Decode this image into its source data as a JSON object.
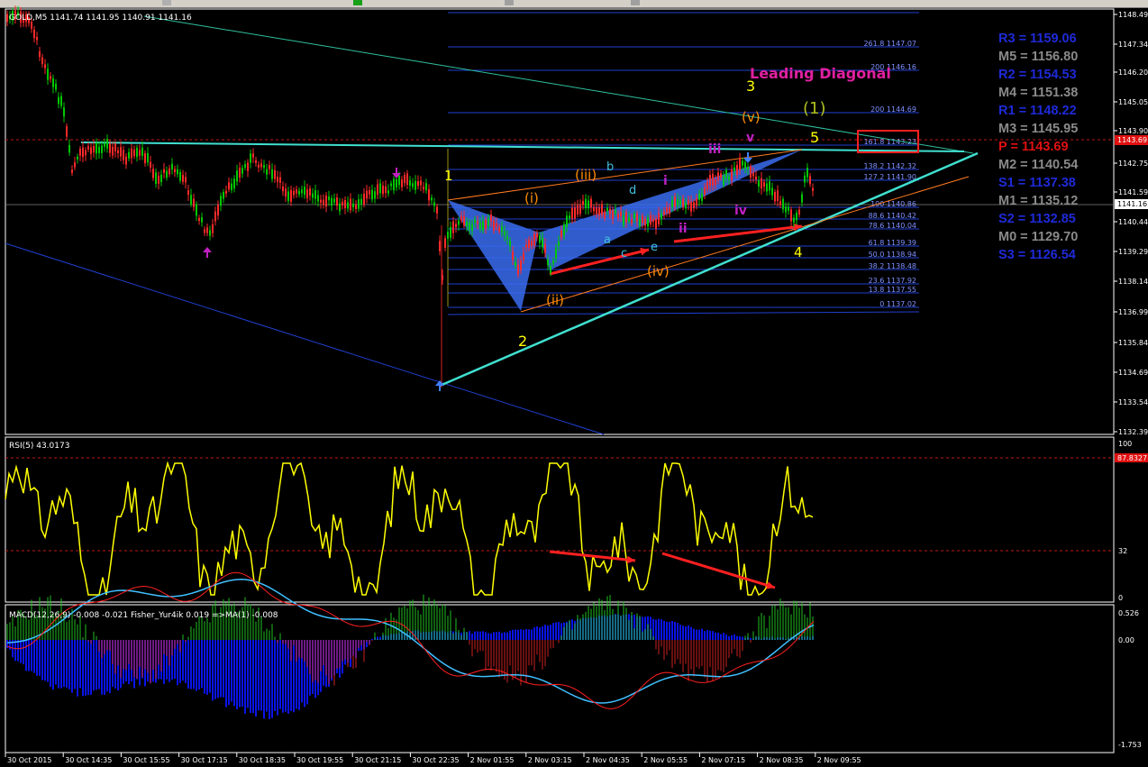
{
  "toolbar": {
    "buttons": [
      "chart-toolbar-button",
      "new-order-button",
      "zoom-in-button",
      "zoom-out-button"
    ]
  },
  "main": {
    "info": "GOLD,M5  1141.74 1141.95 1140.91 1141.16",
    "price_ticks": [
      "1148.49",
      "1147.34",
      "1146.20",
      "1145.05",
      "1143.90",
      "1142.75",
      "1141.59",
      "1140.44",
      "1139.29",
      "1138.14",
      "1136.99",
      "1135.84",
      "1134.69",
      "1133.54",
      "1132.39"
    ],
    "current_price": "1141.16",
    "pivot_price_tag": "1143.69",
    "fib_levels": [
      "261.8 1147.07",
      "200 1146.16",
      "200 1144.69",
      "161.8 1143.23",
      "138.2 1142.32",
      "127.2 1141.90",
      "100 1140.86",
      "88.6 1140.42",
      "78.6 1140.04",
      "61.8 1139.39",
      "50.0 1138.94",
      "38.2 1138.48",
      "23.6 1137.92",
      "13.8 1137.55",
      "0 1137.02"
    ],
    "wave_labels": {
      "w1": "1",
      "w2": "2",
      "w3": "3",
      "w4": "4",
      "w5": "5",
      "i_paren": "(i)",
      "ii_paren": "(ii)",
      "iii_paren": "(iii)",
      "iv_paren": "(iv)",
      "v_paren": "(v)",
      "one_paren": "(1)",
      "a": "a",
      "b": "b",
      "c": "c",
      "d": "d",
      "e": "e",
      "i": "i",
      "ii": "ii",
      "iii": "iii",
      "iv": "iv",
      "v": "v"
    },
    "title_annotation": "Leading Diagonal"
  },
  "pivots": [
    {
      "label": "R3 = 1159.06",
      "color": "#1e2ad8"
    },
    {
      "label": "M5 = 1156.80",
      "color": "#8a8a8a"
    },
    {
      "label": "R2 = 1154.53",
      "color": "#1e2ad8"
    },
    {
      "label": "M4 = 1151.38",
      "color": "#8a8a8a"
    },
    {
      "label": "R1 = 1148.22",
      "color": "#1e2ad8"
    },
    {
      "label": "M3 = 1145.95",
      "color": "#8a8a8a"
    },
    {
      "label": "P   = 1143.69",
      "color": "#e01010"
    },
    {
      "label": "M2 = 1140.54",
      "color": "#8a8a8a"
    },
    {
      "label": "S1 = 1137.38",
      "color": "#1e2ad8"
    },
    {
      "label": "M1 = 1135.12",
      "color": "#8a8a8a"
    },
    {
      "label": "S2 = 1132.85",
      "color": "#1e2ad8"
    },
    {
      "label": "M0 = 1129.70",
      "color": "#8a8a8a"
    },
    {
      "label": "S3 = 1126.54",
      "color": "#1e2ad8"
    }
  ],
  "rsi": {
    "label": "RSI(5) 43.0173",
    "ticks": [
      "100",
      "32",
      "0"
    ],
    "level_tag": "87.8327"
  },
  "macd": {
    "label": "MACD(12,26,9) -0.008 -0.021  Fisher_Yur4ik 0.019  =>MA(1) -0.008",
    "ticks": [
      "0.526",
      "0.00",
      "-1.753"
    ]
  },
  "time_axis": [
    "30 Oct 2015",
    "30 Oct 14:35",
    "30 Oct 15:55",
    "30 Oct 17:15",
    "30 Oct 18:35",
    "30 Oct 19:55",
    "30 Oct 21:15",
    "30 Oct 22:35",
    "2 Nov 01:55",
    "2 Nov 03:15",
    "2 Nov 04:35",
    "2 Nov 05:55",
    "2 Nov 07:15",
    "2 Nov 08:35",
    "2 Nov 09:55"
  ],
  "colors": {
    "bull": "#00c800",
    "bear": "#ff2a2a",
    "rsi": "#ffff00",
    "macd_hist": "#0a14e8",
    "cyan": "#40e0d0",
    "magenta": "#c020c0",
    "orange": "#ff8c00",
    "yellow": "#ffff00"
  }
}
